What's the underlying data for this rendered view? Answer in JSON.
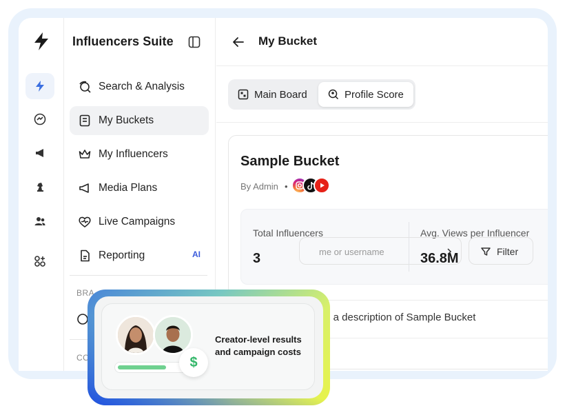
{
  "sidebar": {
    "title": "Influencers Suite",
    "items": [
      {
        "label": "Search & Analysis",
        "icon": "search-analysis-icon"
      },
      {
        "label": "My Buckets",
        "icon": "bucket-icon"
      },
      {
        "label": "My Influencers",
        "icon": "crown-icon"
      },
      {
        "label": "Media Plans",
        "icon": "megaphone-icon"
      },
      {
        "label": "Live Campaigns",
        "icon": "heart-pulse-icon"
      },
      {
        "label": "Reporting",
        "icon": "report-icon",
        "badge": "AI"
      }
    ],
    "section_1": "BRA",
    "section_2": "CO"
  },
  "header": {
    "title": "My Bucket"
  },
  "tabs": [
    {
      "label": "Main Board",
      "active": false
    },
    {
      "label": "Profile Score",
      "active": true
    }
  ],
  "bucket": {
    "title": "Sample Bucket",
    "byline": "By Admin",
    "separator": "•",
    "platforms": [
      "instagram-icon",
      "tiktok-icon",
      "youtube-icon"
    ],
    "stats": [
      {
        "label": "Total Influencers",
        "value": "3"
      },
      {
        "label": "Avg. Views per Influencer",
        "value": "36.8M"
      }
    ],
    "description": "s a description of Sample Bucket",
    "search_placeholder": "me or username",
    "filter_label": "Filter"
  },
  "promo": {
    "text": "Creator-level results and campaign costs",
    "badge_symbol": "$",
    "progress": 0.7
  },
  "colors": {
    "accent": "#3b5bdb",
    "progress": "#6fd190",
    "money": "#34b76a"
  }
}
